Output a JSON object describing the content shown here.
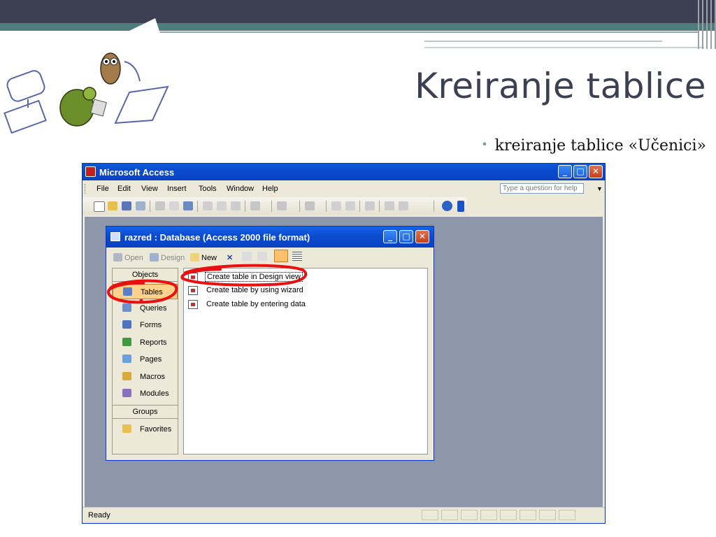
{
  "slide": {
    "title": "Kreiranje tablice",
    "bullet": "kreiranje tablice «Učenici»"
  },
  "access": {
    "window_title": "Microsoft Access",
    "menu": [
      "File",
      "Edit",
      "View",
      "Insert",
      "Tools",
      "Window",
      "Help"
    ],
    "help_placeholder": "Type a question for help",
    "status": "Ready"
  },
  "db": {
    "window_title": "razred : Database (Access 2000 file format)",
    "toolbar": {
      "open": "Open",
      "design": "Design",
      "new": "New"
    },
    "objects_header": "Objects",
    "objects": [
      "Tables",
      "Queries",
      "Forms",
      "Reports",
      "Pages",
      "Macros",
      "Modules"
    ],
    "groups_header": "Groups",
    "groups": [
      "Favorites"
    ],
    "list": [
      "Create table in Design view",
      "Create table by using wizard",
      "Create table by entering data"
    ],
    "selected_object": "Tables"
  },
  "colors": {
    "slide_dark": "#3d4052",
    "slide_teal": "#4e7d7b",
    "xp_blue": "#0b4bd0",
    "workspace": "#8e97aa",
    "annotation_red": "#e81010"
  },
  "icons": {
    "window_buttons": [
      "minimize-icon",
      "maximize-icon",
      "close-icon"
    ]
  }
}
